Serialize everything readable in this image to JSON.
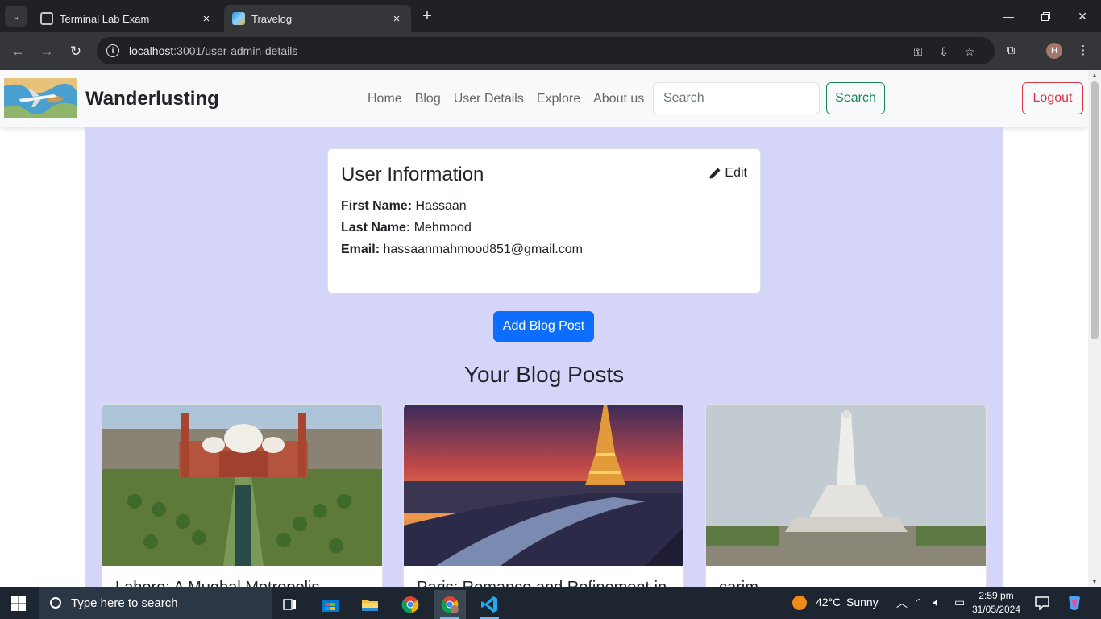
{
  "browser": {
    "tabs": [
      {
        "title": "Terminal Lab Exam",
        "active": false
      },
      {
        "title": "Travelog",
        "active": true
      }
    ],
    "url_host": "localhost",
    "url_path": ":3001/user-admin-details"
  },
  "site": {
    "brand": "Wanderlusting",
    "nav": [
      "Home",
      "Blog",
      "User Details",
      "Explore",
      "About us"
    ],
    "search_placeholder": "Search",
    "search_button": "Search",
    "logout_button": "Logout"
  },
  "user_card": {
    "title": "User Information",
    "edit_label": "Edit",
    "first_name_label": "First Name:",
    "first_name": "Hassaan",
    "last_name_label": "Last Name:",
    "last_name": "Mehmood",
    "email_label": "Email:",
    "email": "hassaanmahmood851@gmail.com"
  },
  "add_button": "Add Blog Post",
  "posts_heading": "Your Blog Posts",
  "posts": [
    {
      "title": "Lahore: A Mughal Metropolis"
    },
    {
      "title": "Paris: Romance and Refinement in"
    },
    {
      "title": "carim"
    }
  ],
  "taskbar": {
    "search_placeholder": "Type here to search",
    "weather_temp": "42°C",
    "weather_desc": "Sunny",
    "time": "2:59 pm",
    "date": "31/05/2024"
  },
  "colors": {
    "page_background": "#d5d5fa",
    "primary": "#0d6efd",
    "success": "#198754",
    "danger": "#dc3545"
  }
}
